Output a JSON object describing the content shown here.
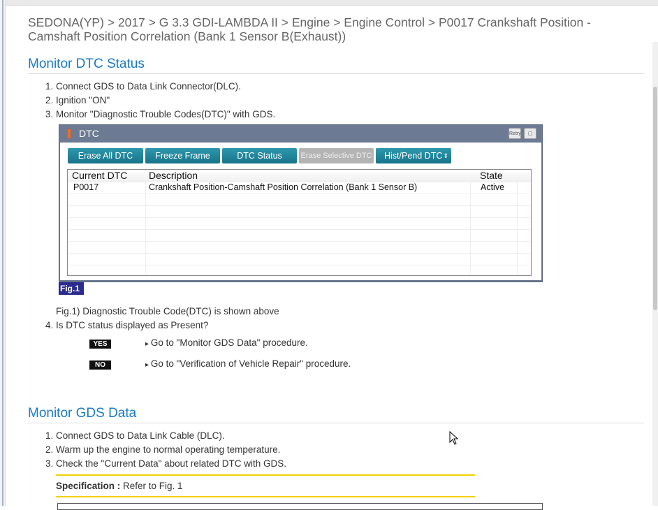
{
  "breadcrumb": "SEDONA(YP) > 2017 > G 3.3 GDI-LAMBDA II > Engine > Engine Control > P0017 Crankshaft Position - Camshaft Position Correlation (Bank 1 Sensor B(Exhaust))",
  "section1": {
    "title": "Monitor DTC Status",
    "steps": [
      "1. Connect GDS to Data Link Connector(DLC).",
      "2. Ignition \"ON\"",
      "3. Monitor \"Diagnostic Trouble Codes(DTC)\" with GDS."
    ],
    "dtc_window": {
      "title": "DTC",
      "icons": [
        "retry-icon",
        "maximize-icon"
      ],
      "retry_label": "Retry",
      "buttons": [
        "Erase All DTC",
        "Freeze Frame",
        "DTC Status",
        "Erase Selective DTC",
        "Hist/Pend DTC"
      ],
      "columns": [
        "Current DTC",
        "Description",
        "State"
      ],
      "rows": [
        {
          "code": "P0017",
          "description": "Crankshaft Position-Camshaft Position Correlation (Bank 1 Sensor B)",
          "state": "Active"
        }
      ]
    },
    "fig_label": "Fig.1",
    "fig_caption": "Fig.1) Diagnostic Trouble Code(DTC) is shown above",
    "step4": "4. Is DTC status displayed as Present?",
    "yes_label": "YES",
    "yes_text": "Go to \"Monitor GDS Data\" procedure.",
    "no_label": "NO",
    "no_text": "Go to \"Verification of Vehicle Repair\" procedure."
  },
  "section2": {
    "title": "Monitor GDS Data",
    "steps": [
      "1. Connect GDS to Data Link Cable (DLC).",
      "2. Warm up the engine to normal operating temperature.",
      "3. Check the \"Current Data\" about related DTC with GDS."
    ],
    "spec_label": "Specification :",
    "spec_value": " Refer to Fig. 1"
  },
  "colors": {
    "heading": "#1a7ac4",
    "button": "#1f8399",
    "spec_line": "#f4d000",
    "fig_label_bg": "#2b2b8f"
  }
}
